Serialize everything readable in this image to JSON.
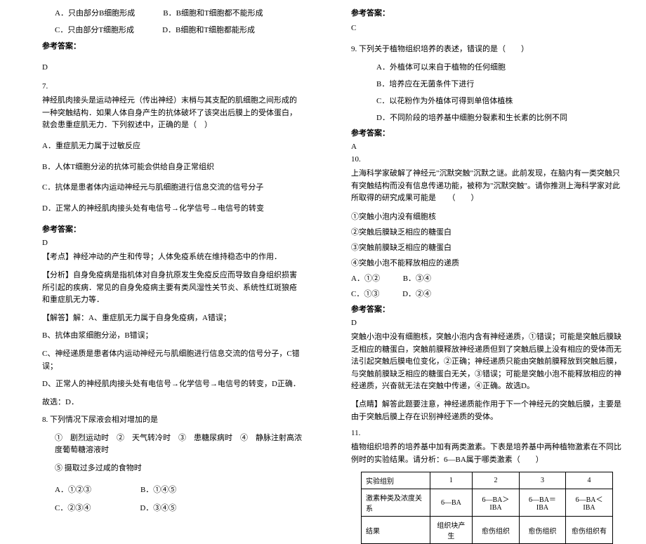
{
  "left": {
    "optA": "A．只由部分B细胞形成",
    "optB": "B．B细胞和T细胞都不能形成",
    "optC": "C．只由部分T细胞形成",
    "optD": "D．B细胞和T细胞都能形成",
    "ansLabel": "参考答案：",
    "ansD": "D",
    "q7num": "7.",
    "q7text": "神经肌肉接头是运动神经元（传出神经）末梢与其支配的肌细胞之间形成的一种突触结构．如果人体自身产生的抗体破坏了该突出后膜上的受体蛋白，就会患重症肌无力．下列叙述中，正确的是（　）",
    "q7A": "A．重症肌无力属于过敏反应",
    "q7B": "B．人体T细胞分泌的抗体可能会供给自身正常组织",
    "q7C": "C．抗体是患者体内运动神经元与肌细胞进行信息交流的信号分子",
    "q7D": "D．正常人的神经肌肉接头处有电信号→化学信号→电信号的转变",
    "q7ansLabel": "参考答案：",
    "q7ans": "D",
    "kaodian": "【考点】神经冲动的产生和传导；人体免疫系统在维持稳态中的作用．",
    "fenxi": "【分析】自身免疫病是指机体对自身抗原发生免疫反应而导致自身组织损害所引起的疾病．常见的自身免疫病主要有类风湿性关节炎、系统性红斑狼疮和重症肌无力等．",
    "jieda1": "【解答】解：A、重症肌无力属于自身免疫病，A错误；",
    "jieda2": "B、抗体由浆细胞分泌，B错误；",
    "jieda3": "C、神经递质是患者体内运动神经元与肌细胞进行信息交流的信号分子，C错误；",
    "jieda4": "D、正常人的神经肌肉接头处有电信号→化学信号→电信号的转变，D正确．",
    "jieda5": "故选：D．",
    "q8num": "8.",
    "q8stem": "下列情况下尿液会相对增加的是",
    "q8_1": "①　剧烈运动时　②　天气转冷时　③　患糖尿病时　④　静脉注射高浓度葡萄糖溶液时",
    "q8_2": "⑤ 摄取过多过咸的食物时",
    "q8A": "A．①②③",
    "q8B": "B．①④⑤",
    "q8C": "C．②③④",
    "q8D": "D．③④⑤"
  },
  "right": {
    "ansLabel": "参考答案：",
    "ansC": "C",
    "q9": "9. 下列关于植物组织培养的表述，错误的是（　　）",
    "q9A": "A．外植体可以来自于植物的任何细胞",
    "q9B": "B．培养应在无菌条件下进行",
    "q9C": "C．以花粉作为外植体可得到单倍体植株",
    "q9D": "D．不同阶段的培养基中细胞分裂素和生长素的比例不同",
    "q9ansLabel": "参考答案：",
    "q9ans": "A",
    "q10num": "10.",
    "q10stem": "上海科学家破解了神经元\"沉默突触\"沉默之谜。此前发现，在脑内有一类突触只有突触结构而没有信息传递功能，被称为\"沉默突触\"。请你推测上海科学家对此所取得的研究成果可能是　　（　　）",
    "q10_1": "①突触小泡内没有细胞核",
    "q10_2": "②突触后膜缺乏相应的糖蛋白",
    "q10_3": "③突触前膜缺乏相应的糖蛋白",
    "q10_4": "④突触小泡不能释放相应的递质",
    "q10A": "A．①②",
    "q10B": "B．③④",
    "q10C": "C．①③",
    "q10D": "D．②④",
    "q10ansLabel": "参考答案：",
    "q10ans": "D",
    "q10exp": "突触小泡中没有细胞核，突触小泡内含有神经递质，①错误；可能是突触后膜缺乏相应的糖蛋白，突触前膜释放神经递质但到了突触后膜上没有相应的受体而无法引起突触后膜电位变化，②正确；神经递质只能由突触前膜释放到突触后膜，与突触前膜缺乏相应的糖蛋白无关，③错误；可能是突触小泡不能释放相应的神经递质，兴奋就无法在突触中传递，④正确。故选D。",
    "q10dianjing": "【点睛】解答此题要注意，神经递质能作用于下一个神经元的突触后膜，主要是由于突触后膜上存在识别神经递质的受体。",
    "q11num": "11.",
    "q11stem": "植物组织培养的培养基中加有两类激素。下表是培养基中两种植物激素在不同比例时的实验结果。请分析：6—BA属于哪类激素（　　）",
    "table": {
      "h1": "实验组别",
      "h2": "1",
      "h3": "2",
      "h4": "3",
      "h5": "4",
      "r2c1": "激素种类及浓度关系",
      "r2c2": "6—BA",
      "r2c3": "6—BA＞IBA",
      "r2c4": "6—BA＝IBA",
      "r2c5": "6—BA＜IBA",
      "r3c1": "结果",
      "r3c2": "组织块产生",
      "r3c3": "愈伤组织",
      "r3c4": "愈伤组织",
      "r3c5": "愈伤组织有"
    }
  }
}
